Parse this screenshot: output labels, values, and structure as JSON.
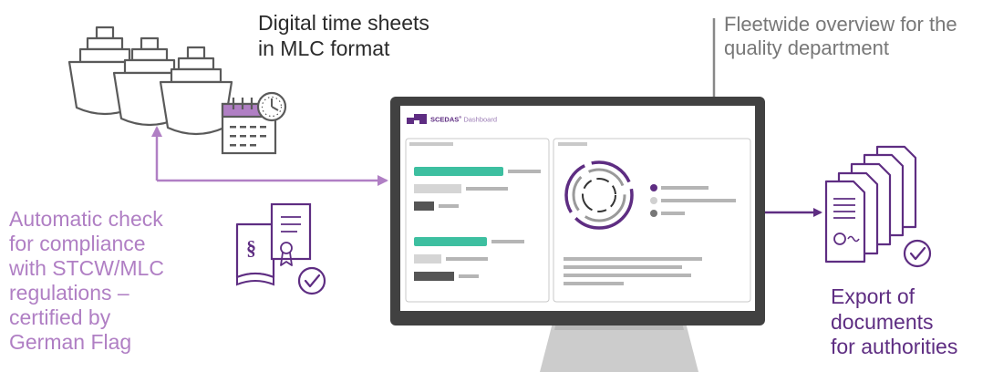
{
  "texts": {
    "time_sheets": [
      "Digital time sheets",
      "in MLC format"
    ],
    "fleet_overview": [
      "Fleetwide overview for the",
      "quality department"
    ],
    "compliance": [
      "Automatic check",
      "for compliance",
      "with STCW/MLC",
      "regulations –",
      "certified by",
      "German Flag"
    ],
    "export": [
      "Export of",
      "documents",
      "for authorities"
    ]
  },
  "screen": {
    "brand": "SCEDAS",
    "brand_suffix": "Dashboard",
    "section_mark": "§"
  },
  "colors": {
    "purple": "#5e2d82",
    "lilac": "#b07fc4",
    "teal": "#3dbfa0",
    "gray": "#777777",
    "monitor": "#414141"
  }
}
